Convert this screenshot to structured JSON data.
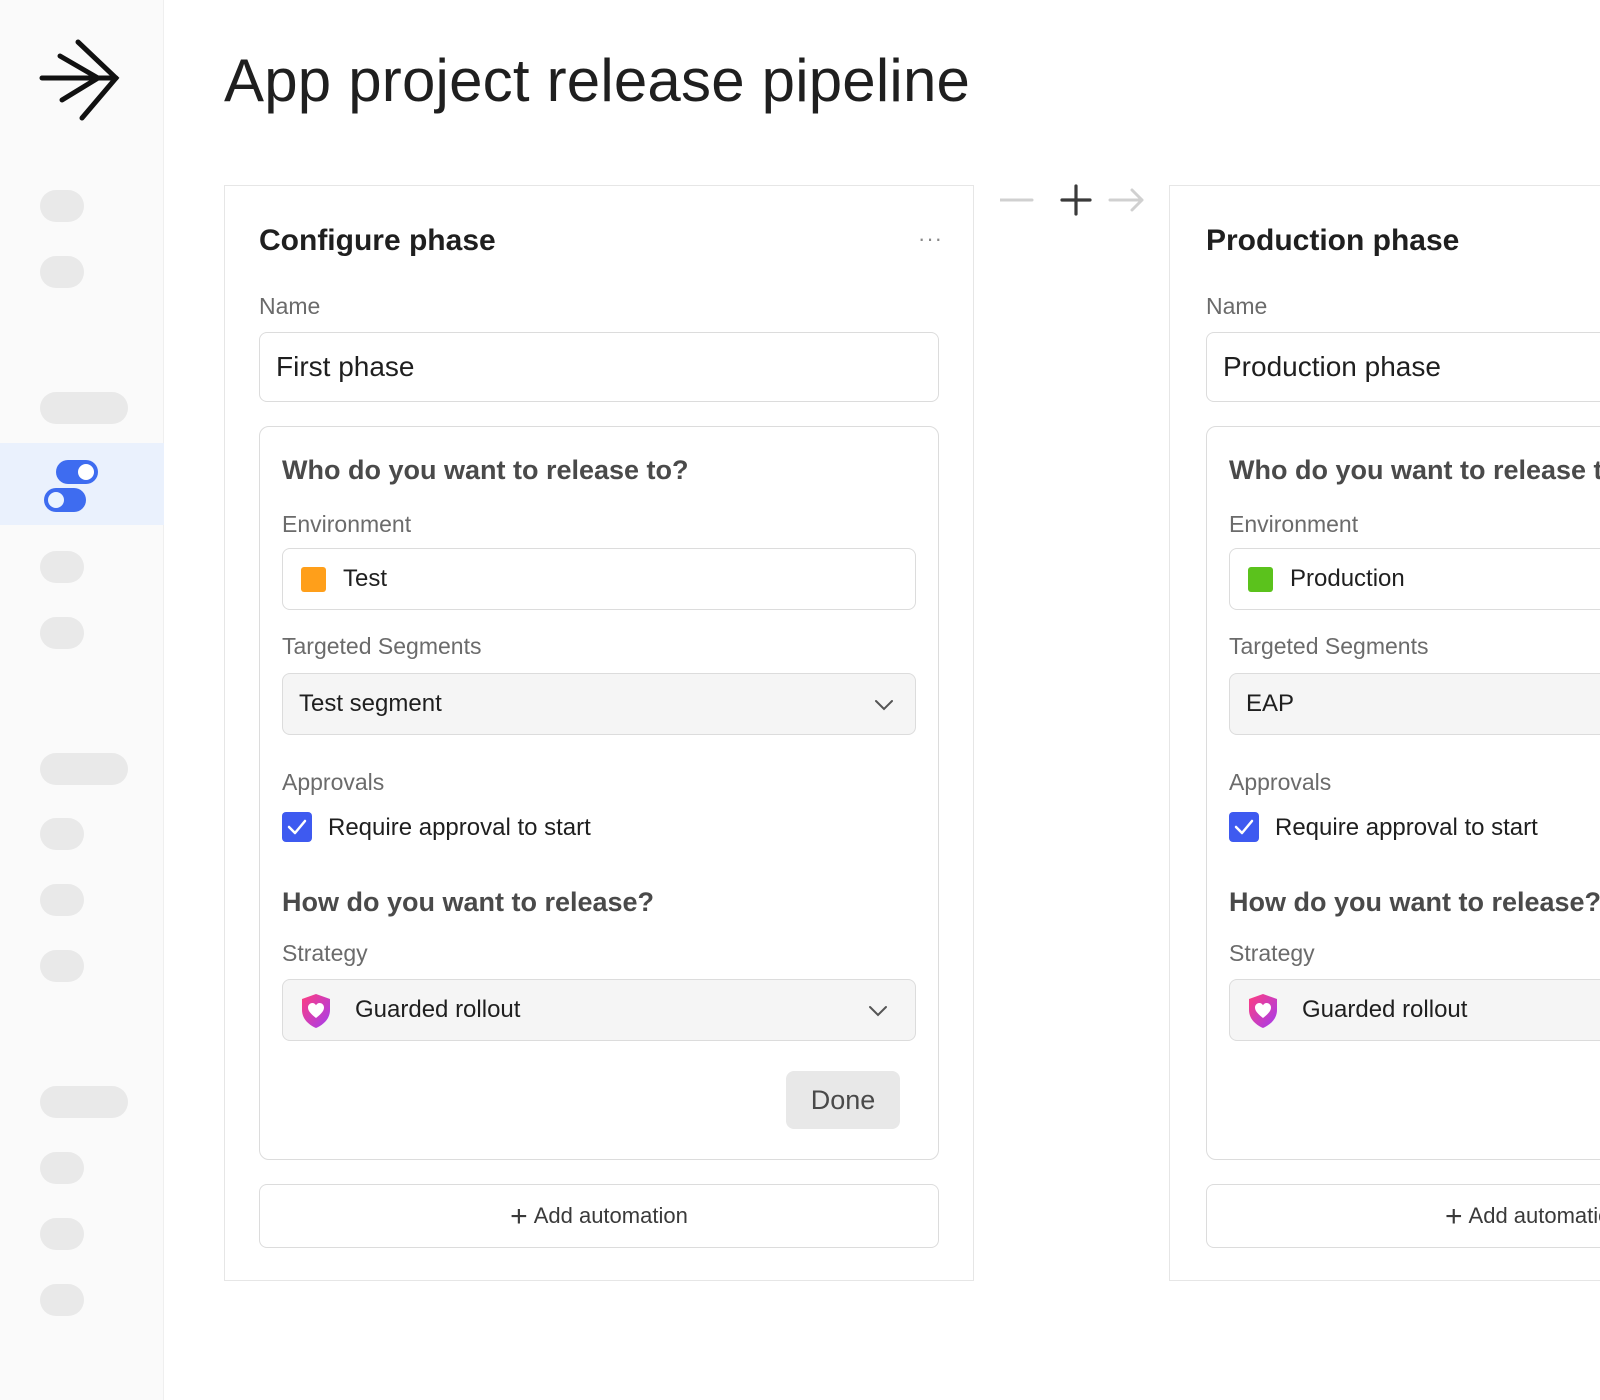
{
  "page": {
    "title": "App project release pipeline"
  },
  "icons": {
    "logo": "arrow-burst-logo-icon",
    "active_nav": "toggle-switches-icon",
    "more": "more-horizontal-icon",
    "chevron": "chevron-down-icon",
    "shield": "shield-heart-icon",
    "check": "check-icon",
    "plus": "plus-icon"
  },
  "colors": {
    "accent": "#3e5af0",
    "test_env": "#ff9f1a",
    "production_env": "#5bc21c",
    "sidebar_active": "#eaf1fd"
  },
  "phases": [
    {
      "title": "Configure phase",
      "more_label": "···",
      "name_label": "Name",
      "name_value": "First phase",
      "release_to_heading": "Who do you want to release to?",
      "environment_label": "Environment",
      "environment_value": "Test",
      "segments_label": "Targeted Segments",
      "segments_value": "Test segment",
      "approvals_label": "Approvals",
      "approval_checkbox_label": "Require approval to start",
      "approval_checked": true,
      "how_heading": "How do you want to release?",
      "strategy_label": "Strategy",
      "strategy_value": "Guarded rollout",
      "done_label": "Done",
      "add_automation_label": "Add automation"
    },
    {
      "title": "Production phase",
      "name_label": "Name",
      "name_value": "Production phase",
      "release_to_heading": "Who do you want to release to?",
      "environment_label": "Environment",
      "environment_value": "Production",
      "segments_label": "Targeted Segments",
      "segments_value": "EAP",
      "approvals_label": "Approvals",
      "approval_checkbox_label": "Require approval to start",
      "approval_checked": true,
      "how_heading": "How do you want to release?",
      "strategy_label": "Strategy",
      "strategy_value": "Guarded rollout",
      "add_automation_label": "Add automation"
    }
  ]
}
